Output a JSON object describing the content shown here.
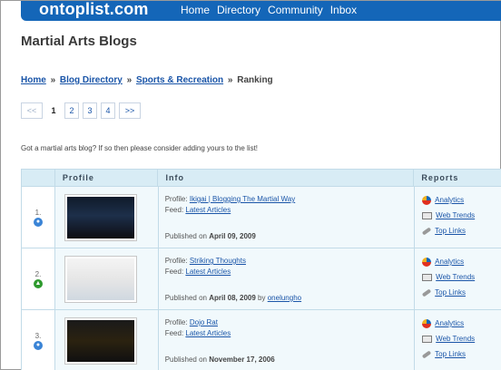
{
  "header": {
    "logo": "ontoplist.com",
    "nav": [
      "Home",
      "Directory",
      "Community",
      "Inbox"
    ]
  },
  "page_title": "Martial Arts Blogs",
  "breadcrumb": {
    "items": [
      "Home",
      "Blog Directory",
      "Sports & Recreation"
    ],
    "current": "Ranking",
    "separator": "»"
  },
  "pager": {
    "prev": "<<",
    "pages": [
      "1",
      "2",
      "3",
      "4"
    ],
    "next": ">>"
  },
  "intro": "Got a martial arts blog? If so then please consider adding yours to the list!",
  "table": {
    "headers": {
      "profile": "Profile",
      "info": "Info",
      "reports": "Reports"
    },
    "labels": {
      "profile": "Profile:",
      "feed": "Feed:",
      "published": "Published on",
      "by": "by"
    },
    "report_links": {
      "analytics": "Analytics",
      "web_trends": "Web Trends",
      "top_links": "Top Links"
    },
    "rows": [
      {
        "rank": "1.",
        "trend": "same",
        "profile": "Ikigai | Blogging The Martial Way",
        "feed": "Latest Articles",
        "date": "April 09, 2009",
        "author": ""
      },
      {
        "rank": "2.",
        "trend": "up",
        "profile": "Striking Thoughts",
        "feed": "Latest Articles",
        "date": "April 08, 2009",
        "author": "onelungho"
      },
      {
        "rank": "3.",
        "trend": "same",
        "profile": "Dojo Rat",
        "feed": "Latest Articles",
        "date": "November 17, 2006",
        "author": ""
      }
    ]
  },
  "colors": {
    "brand": "#1466b8",
    "link": "#1a55a8",
    "header_bg": "#d8ecf5",
    "row_bg": "#f1f9fc"
  }
}
